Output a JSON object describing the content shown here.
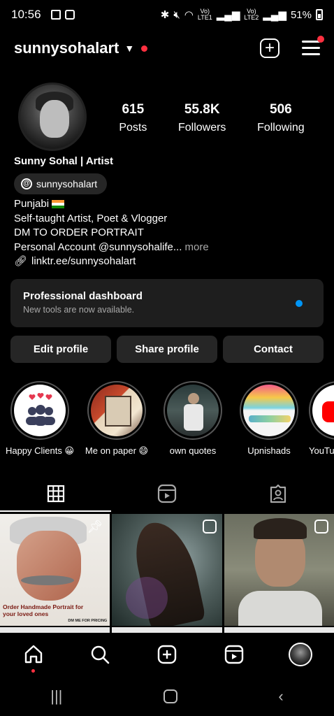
{
  "status_bar": {
    "time": "10:56",
    "net1": "Vo)\nLTE1",
    "net2": "Vo)\nLTE2",
    "battery": "51%"
  },
  "header": {
    "username": "sunnysohalart",
    "icons": [
      "chevron-down-icon",
      "create-icon",
      "menu-icon"
    ]
  },
  "profile": {
    "stats": [
      {
        "value": "615",
        "label": "Posts"
      },
      {
        "value": "55.8K",
        "label": "Followers"
      },
      {
        "value": "506",
        "label": "Following"
      }
    ],
    "display_name": "Sunny Sohal | Artist",
    "threads_handle": "sunnysohalart",
    "bio": {
      "line1": "Punjabi",
      "line2": "Self-taught Artist, Poet & Vlogger",
      "line3": "DM TO ORDER  PORTRAIT",
      "line4": "Personal Account @sunnysohalife...",
      "more": " more",
      "link": "linktr.ee/sunnysohalart"
    }
  },
  "dashboard": {
    "title": "Professional dashboard",
    "subtitle": "New tools are now available."
  },
  "buttons": {
    "edit": "Edit profile",
    "share": "Share profile",
    "contact": "Contact"
  },
  "highlights": [
    {
      "label": "Happy Clients 😀"
    },
    {
      "label": "Me on paper 😄"
    },
    {
      "label": "own quotes"
    },
    {
      "label": "Upnishads"
    },
    {
      "label": "YouTu"
    }
  ],
  "post1_text": {
    "line1": "Order Handmade Portrait for",
    "line2": "your loved ones",
    "tag": "DM ME FOR PRICING"
  },
  "colors": {
    "accent_blue": "#0095f6",
    "notification_red": "#ff3040",
    "surface": "#262626"
  }
}
